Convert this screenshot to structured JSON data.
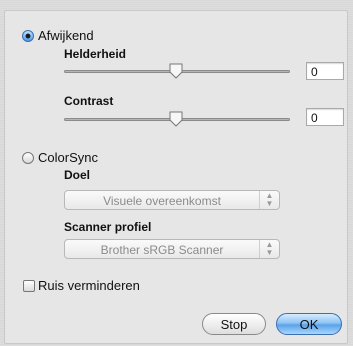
{
  "mode_custom": {
    "label": "Afwijkend",
    "selected": true
  },
  "brightness": {
    "label": "Helderheid",
    "value": "0",
    "level": 0.5
  },
  "contrast": {
    "label": "Contrast",
    "value": "0",
    "level": 0.5
  },
  "mode_colorsync": {
    "label": "ColorSync",
    "selected": false
  },
  "target": {
    "label": "Doel",
    "selected": "Visuele overeenkomst"
  },
  "scanner_profile": {
    "label": "Scanner profiel",
    "selected": "Brother sRGB Scanner"
  },
  "noise_reduction": {
    "label": "Ruis verminderen",
    "checked": false
  },
  "buttons": {
    "stop": "Stop",
    "ok": "OK"
  },
  "colors": {
    "accent": "#5aa3ea"
  }
}
